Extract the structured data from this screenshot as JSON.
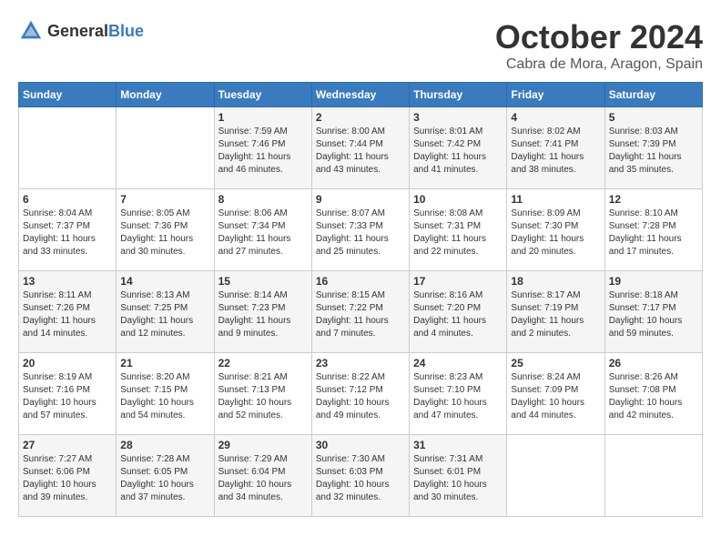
{
  "header": {
    "logo_general": "General",
    "logo_blue": "Blue",
    "month": "October 2024",
    "location": "Cabra de Mora, Aragon, Spain"
  },
  "days_of_week": [
    "Sunday",
    "Monday",
    "Tuesday",
    "Wednesday",
    "Thursday",
    "Friday",
    "Saturday"
  ],
  "weeks": [
    [
      {
        "day": "",
        "sunrise": "",
        "sunset": "",
        "daylight": ""
      },
      {
        "day": "",
        "sunrise": "",
        "sunset": "",
        "daylight": ""
      },
      {
        "day": "1",
        "sunrise": "Sunrise: 7:59 AM",
        "sunset": "Sunset: 7:46 PM",
        "daylight": "Daylight: 11 hours and 46 minutes."
      },
      {
        "day": "2",
        "sunrise": "Sunrise: 8:00 AM",
        "sunset": "Sunset: 7:44 PM",
        "daylight": "Daylight: 11 hours and 43 minutes."
      },
      {
        "day": "3",
        "sunrise": "Sunrise: 8:01 AM",
        "sunset": "Sunset: 7:42 PM",
        "daylight": "Daylight: 11 hours and 41 minutes."
      },
      {
        "day": "4",
        "sunrise": "Sunrise: 8:02 AM",
        "sunset": "Sunset: 7:41 PM",
        "daylight": "Daylight: 11 hours and 38 minutes."
      },
      {
        "day": "5",
        "sunrise": "Sunrise: 8:03 AM",
        "sunset": "Sunset: 7:39 PM",
        "daylight": "Daylight: 11 hours and 35 minutes."
      }
    ],
    [
      {
        "day": "6",
        "sunrise": "Sunrise: 8:04 AM",
        "sunset": "Sunset: 7:37 PM",
        "daylight": "Daylight: 11 hours and 33 minutes."
      },
      {
        "day": "7",
        "sunrise": "Sunrise: 8:05 AM",
        "sunset": "Sunset: 7:36 PM",
        "daylight": "Daylight: 11 hours and 30 minutes."
      },
      {
        "day": "8",
        "sunrise": "Sunrise: 8:06 AM",
        "sunset": "Sunset: 7:34 PM",
        "daylight": "Daylight: 11 hours and 27 minutes."
      },
      {
        "day": "9",
        "sunrise": "Sunrise: 8:07 AM",
        "sunset": "Sunset: 7:33 PM",
        "daylight": "Daylight: 11 hours and 25 minutes."
      },
      {
        "day": "10",
        "sunrise": "Sunrise: 8:08 AM",
        "sunset": "Sunset: 7:31 PM",
        "daylight": "Daylight: 11 hours and 22 minutes."
      },
      {
        "day": "11",
        "sunrise": "Sunrise: 8:09 AM",
        "sunset": "Sunset: 7:30 PM",
        "daylight": "Daylight: 11 hours and 20 minutes."
      },
      {
        "day": "12",
        "sunrise": "Sunrise: 8:10 AM",
        "sunset": "Sunset: 7:28 PM",
        "daylight": "Daylight: 11 hours and 17 minutes."
      }
    ],
    [
      {
        "day": "13",
        "sunrise": "Sunrise: 8:11 AM",
        "sunset": "Sunset: 7:26 PM",
        "daylight": "Daylight: 11 hours and 14 minutes."
      },
      {
        "day": "14",
        "sunrise": "Sunrise: 8:13 AM",
        "sunset": "Sunset: 7:25 PM",
        "daylight": "Daylight: 11 hours and 12 minutes."
      },
      {
        "day": "15",
        "sunrise": "Sunrise: 8:14 AM",
        "sunset": "Sunset: 7:23 PM",
        "daylight": "Daylight: 11 hours and 9 minutes."
      },
      {
        "day": "16",
        "sunrise": "Sunrise: 8:15 AM",
        "sunset": "Sunset: 7:22 PM",
        "daylight": "Daylight: 11 hours and 7 minutes."
      },
      {
        "day": "17",
        "sunrise": "Sunrise: 8:16 AM",
        "sunset": "Sunset: 7:20 PM",
        "daylight": "Daylight: 11 hours and 4 minutes."
      },
      {
        "day": "18",
        "sunrise": "Sunrise: 8:17 AM",
        "sunset": "Sunset: 7:19 PM",
        "daylight": "Daylight: 11 hours and 2 minutes."
      },
      {
        "day": "19",
        "sunrise": "Sunrise: 8:18 AM",
        "sunset": "Sunset: 7:17 PM",
        "daylight": "Daylight: 10 hours and 59 minutes."
      }
    ],
    [
      {
        "day": "20",
        "sunrise": "Sunrise: 8:19 AM",
        "sunset": "Sunset: 7:16 PM",
        "daylight": "Daylight: 10 hours and 57 minutes."
      },
      {
        "day": "21",
        "sunrise": "Sunrise: 8:20 AM",
        "sunset": "Sunset: 7:15 PM",
        "daylight": "Daylight: 10 hours and 54 minutes."
      },
      {
        "day": "22",
        "sunrise": "Sunrise: 8:21 AM",
        "sunset": "Sunset: 7:13 PM",
        "daylight": "Daylight: 10 hours and 52 minutes."
      },
      {
        "day": "23",
        "sunrise": "Sunrise: 8:22 AM",
        "sunset": "Sunset: 7:12 PM",
        "daylight": "Daylight: 10 hours and 49 minutes."
      },
      {
        "day": "24",
        "sunrise": "Sunrise: 8:23 AM",
        "sunset": "Sunset: 7:10 PM",
        "daylight": "Daylight: 10 hours and 47 minutes."
      },
      {
        "day": "25",
        "sunrise": "Sunrise: 8:24 AM",
        "sunset": "Sunset: 7:09 PM",
        "daylight": "Daylight: 10 hours and 44 minutes."
      },
      {
        "day": "26",
        "sunrise": "Sunrise: 8:26 AM",
        "sunset": "Sunset: 7:08 PM",
        "daylight": "Daylight: 10 hours and 42 minutes."
      }
    ],
    [
      {
        "day": "27",
        "sunrise": "Sunrise: 7:27 AM",
        "sunset": "Sunset: 6:06 PM",
        "daylight": "Daylight: 10 hours and 39 minutes."
      },
      {
        "day": "28",
        "sunrise": "Sunrise: 7:28 AM",
        "sunset": "Sunset: 6:05 PM",
        "daylight": "Daylight: 10 hours and 37 minutes."
      },
      {
        "day": "29",
        "sunrise": "Sunrise: 7:29 AM",
        "sunset": "Sunset: 6:04 PM",
        "daylight": "Daylight: 10 hours and 34 minutes."
      },
      {
        "day": "30",
        "sunrise": "Sunrise: 7:30 AM",
        "sunset": "Sunset: 6:03 PM",
        "daylight": "Daylight: 10 hours and 32 minutes."
      },
      {
        "day": "31",
        "sunrise": "Sunrise: 7:31 AM",
        "sunset": "Sunset: 6:01 PM",
        "daylight": "Daylight: 10 hours and 30 minutes."
      },
      {
        "day": "",
        "sunrise": "",
        "sunset": "",
        "daylight": ""
      },
      {
        "day": "",
        "sunrise": "",
        "sunset": "",
        "daylight": ""
      }
    ]
  ]
}
